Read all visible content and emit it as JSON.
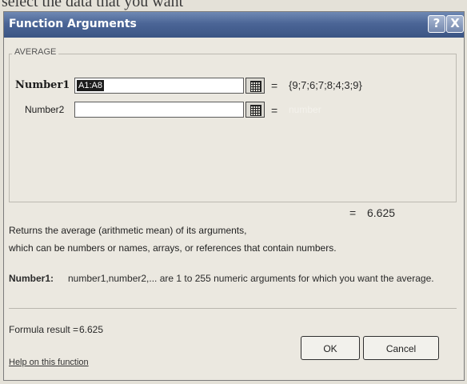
{
  "page": {
    "background_text": "select the data that you want"
  },
  "dialog": {
    "title": "Function Arguments",
    "help_glyph": "?",
    "close_glyph": "X",
    "function_name": "AVERAGE",
    "args": [
      {
        "label": "Number1",
        "value": "A1:A8",
        "result": "{9;7;6;7;8;4;3;9}"
      },
      {
        "label": "Number2",
        "value": "",
        "result": "number"
      }
    ],
    "equals": "=",
    "formula_value": "6.625",
    "description_line1": "Returns the average (arithmetic mean) of its arguments,",
    "description_line2": "which can be numbers or names, arrays, or references that contain numbers.",
    "arg_description_name": "Number1:",
    "arg_description_text": "number1,number2,... are 1 to 255 numeric arguments for which you want the average.",
    "formula_result_label": "Formula result =",
    "formula_result_value": "6.625",
    "help_link": "Help on this function",
    "ok_label": "OK",
    "cancel_label": "Cancel"
  },
  "colors": {
    "titlebar": "#4b6596",
    "dialog_bg": "#ebe8e0"
  },
  "icons": {
    "collapse": "collapse-dialog-icon",
    "help": "help-icon",
    "close": "close-icon"
  }
}
